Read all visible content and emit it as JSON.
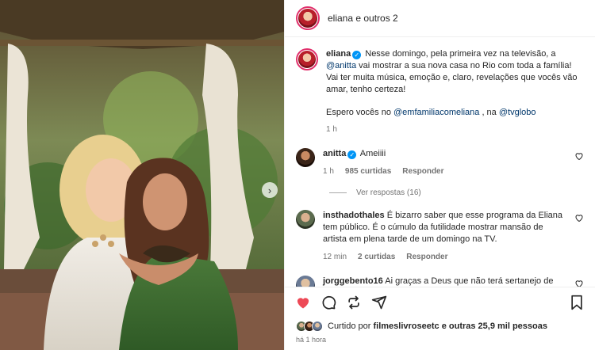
{
  "header": {
    "title": "eliana e outros 2"
  },
  "caption": {
    "username": "eliana",
    "text_before": "Nesse domingo, pela primeira vez na televisão, a",
    "mention_1": "@anitta",
    "text_after": "vai mostrar a sua nova casa no Rio com toda a família! Vai ter muita música, emoção e, claro, revelações que vocês vão amar, tenho certeza!",
    "line2_prefix": "Espero vocês no",
    "mention_2": "@emfamiliacomeliana",
    "line2_sep": ", na",
    "mention_3": "@tvglobo",
    "time": "1 h"
  },
  "comments": [
    {
      "username": "anitta",
      "verified": true,
      "text": "Ameiiii",
      "time": "1 h",
      "likes": "985 curtidas",
      "reply": "Responder",
      "view_replies": "Ver respostas (16)"
    },
    {
      "username": "insthadothales",
      "text": "É bizarro saber que esse programa da Eliana tem público. É o cúmulo da futilidade mostrar mansão de artista em plena tarde de um domingo na TV.",
      "time": "12 min",
      "likes": "2 curtidas",
      "reply": "Responder"
    },
    {
      "username": "jorggebento16",
      "text": "Ai graças a Deus que não terá sertanejo de"
    }
  ],
  "liked_by": {
    "prefix": "Curtido por",
    "user": "filmeslivroseetc",
    "suffix": "e outras 25,9 mil pessoas"
  },
  "post_time": "há 1 hora",
  "icons": {
    "like": "heart-icon",
    "comment": "comment-icon",
    "share": "share-icon",
    "repost": "repost-icon",
    "save": "bookmark-icon",
    "next": "chevron-right-icon"
  },
  "colors": {
    "like_active": "#ed4956",
    "verified": "#0095f6",
    "mention": "#00376b"
  }
}
